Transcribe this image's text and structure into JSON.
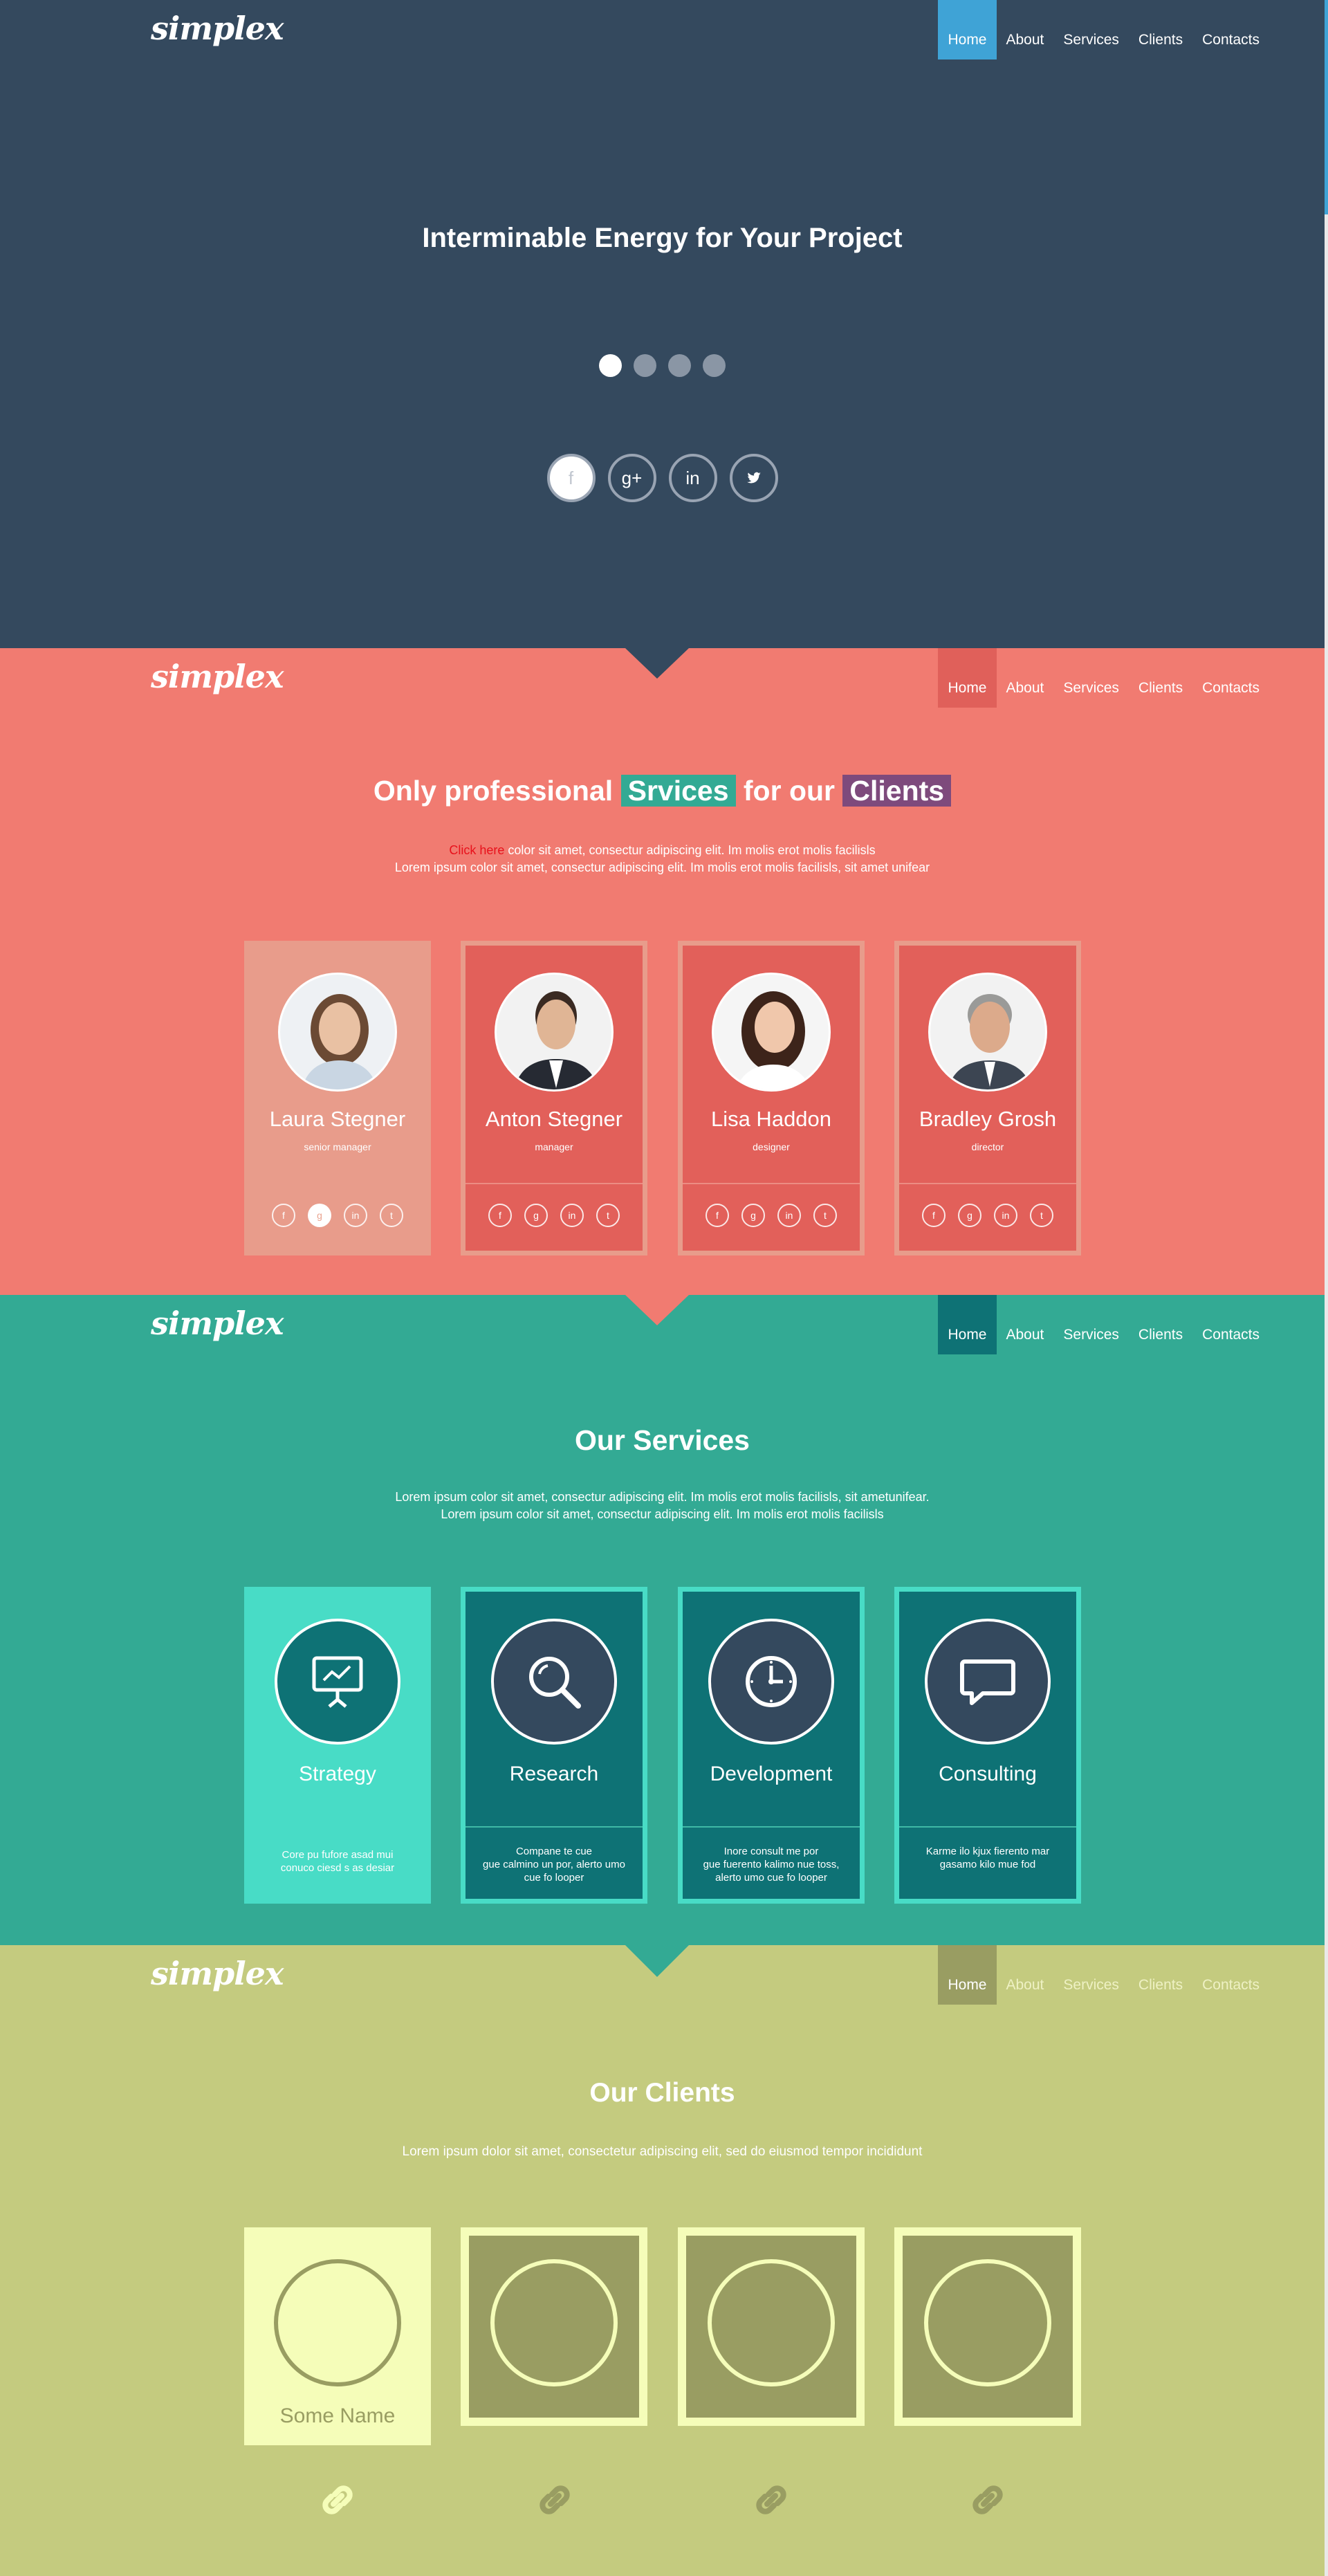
{
  "brand": {
    "logo": "simplex"
  },
  "nav": [
    "Home",
    "About",
    "Services",
    "Clients",
    "Contacts"
  ],
  "colors": {
    "hero": "#34495e",
    "team": "#f17b71",
    "services": "#33aa94",
    "clients": "#c4cb7f",
    "accent_blue": "#3fa3d6"
  },
  "hero": {
    "title": "Interminable Energy for Your Project",
    "social": [
      "f",
      "g+",
      "in",
      "t"
    ]
  },
  "team": {
    "title_part1": "Only professional",
    "title_highlight1": "Srvices",
    "title_part2": "for our",
    "title_highlight2": "Clients",
    "click_link": "Click here",
    "intro_line1": " color sit amet, consectur adipiscing elit. Im molis erot molis facilisls",
    "intro_line2": "Lorem ipsum color sit amet, consectur adipiscing elit. Im molis erot molis facilisls, sit amet unifear",
    "members": [
      {
        "name": "Laura Stegner",
        "role": "senior manager"
      },
      {
        "name": "Anton Stegner",
        "role": "manager"
      },
      {
        "name": "Lisa Haddon",
        "role": "designer"
      },
      {
        "name": "Bradley Grosh",
        "role": "director"
      }
    ],
    "social": [
      "f",
      "g",
      "in",
      "t"
    ]
  },
  "services": {
    "title": "Our Services",
    "intro_line1": "Lorem ipsum color sit amet, consectur adipiscing elit. Im molis erot molis facilisls, sit ametunifear.",
    "intro_line2": "Lorem ipsum color sit amet, consectur adipiscing elit. Im molis erot molis facilisls",
    "items": [
      {
        "name": "Strategy",
        "icon": "presentation-icon",
        "desc1": "Core pu fufore asad mui",
        "desc2": "conuco ciesd s as desiar",
        "desc3": ""
      },
      {
        "name": "Research",
        "icon": "search-icon",
        "desc1": "Compane te cue",
        "desc2": "gue calmino un por, alerto umo",
        "desc3": "cue fo looper"
      },
      {
        "name": "Development",
        "icon": "clock-icon",
        "desc1": "Inore consult me por",
        "desc2": "gue fuerento kalimo nue toss,",
        "desc3": "alerto umo cue fo looper"
      },
      {
        "name": "Consulting",
        "icon": "chat-bubble-icon",
        "desc1": "Karme ilo kjux fierento mar",
        "desc2": "gasamo kilo mue fod",
        "desc3": ""
      }
    ]
  },
  "clients": {
    "title": "Our Clients",
    "intro": "Lorem ipsum dolor sit amet, consectetur adipiscing elit, sed do  eiusmod tempor incididunt",
    "first_name": "Some Name",
    "link_icon": "link-icon"
  }
}
